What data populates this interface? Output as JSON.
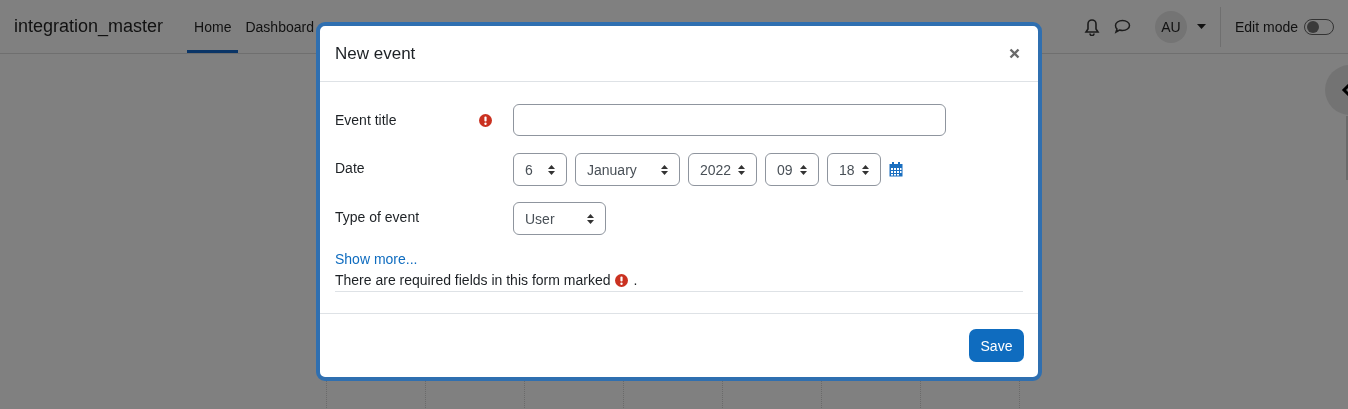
{
  "navbar": {
    "brand": "integration_master",
    "items": [
      {
        "label": "Home",
        "selected": true
      },
      {
        "label": "Dashboard",
        "selected": false
      }
    ],
    "avatar": "AU",
    "edit_mode": {
      "label": "Edit mode",
      "on": false
    }
  },
  "modal": {
    "title": "New event",
    "fields": [
      {
        "kind": "text",
        "label": "Event title",
        "required": true
      },
      {
        "kind": "date",
        "label": "Date",
        "required": false,
        "selects": [
          "6",
          "January",
          "2022",
          "09",
          "18"
        ]
      },
      {
        "kind": "select",
        "label": "Type of event",
        "required": false,
        "selects": [
          "User"
        ]
      }
    ],
    "show_more": "Show more...",
    "required_note": {
      "before": "There are required fields in this form marked",
      "after": "."
    },
    "save": "Save"
  }
}
